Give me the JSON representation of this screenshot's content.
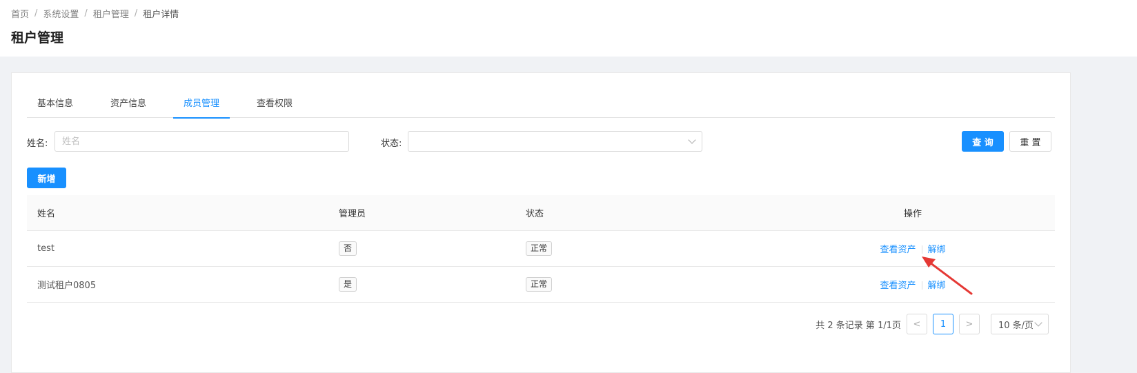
{
  "breadcrumb": [
    "首页",
    "系统设置",
    "租户管理",
    "租户详情"
  ],
  "page_title": "租户管理",
  "tabs": [
    {
      "label": "基本信息",
      "active": false
    },
    {
      "label": "资产信息",
      "active": false
    },
    {
      "label": "成员管理",
      "active": true
    },
    {
      "label": "查看权限",
      "active": false
    }
  ],
  "filters": {
    "name_label": "姓名:",
    "name_placeholder": "姓名",
    "name_value": "",
    "status_label": "状态:",
    "status_value": ""
  },
  "buttons": {
    "query": "查 询",
    "reset": "重 置",
    "add": "新增"
  },
  "table": {
    "columns": [
      "姓名",
      "管理员",
      "状态",
      "操作"
    ],
    "rows": [
      {
        "name": "test",
        "admin": "否",
        "status": "正常",
        "actions": [
          "查看资产",
          "解绑"
        ]
      },
      {
        "name": "测试租户0805",
        "admin": "是",
        "status": "正常",
        "actions": [
          "查看资产",
          "解绑"
        ]
      }
    ]
  },
  "pagination": {
    "summary": "共 2 条记录 第 1/1页",
    "prev": "<",
    "current": "1",
    "next": ">",
    "page_size": "10 条/页"
  },
  "colors": {
    "primary": "#1890ff",
    "arrow": "#e53935"
  }
}
